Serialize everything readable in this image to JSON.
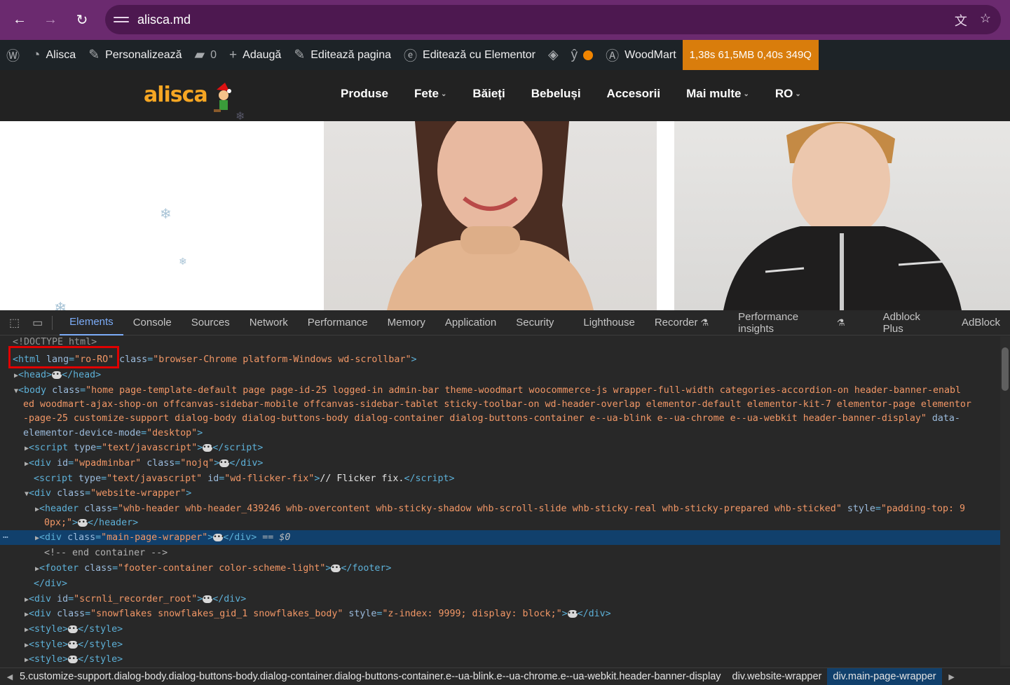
{
  "browser": {
    "url": "alisca.md",
    "back_icon": "←",
    "forward_icon": "→",
    "reload_icon": "↻"
  },
  "wpbar": {
    "site_name": "Alisca",
    "customize": "Personalizează",
    "comments_count": "0",
    "add_new": "Adaugă",
    "edit_page": "Editează pagina",
    "edit_elementor": "Editează cu Elementor",
    "woodmart": "WoodMart",
    "perf": "1,38s  61,5MB  0,40s  349Q"
  },
  "site": {
    "logo_text": "alisca",
    "nav": [
      "Produse",
      "Fete",
      "Băieți",
      "Bebeluși",
      "Accesorii",
      "Mai multe",
      "RO"
    ],
    "caret": "⌄"
  },
  "devtools": {
    "tabs": [
      "Elements",
      "Console",
      "Sources",
      "Network",
      "Performance",
      "Memory",
      "Application",
      "Security",
      "Lighthouse",
      "Recorder",
      "Performance insights",
      "Adblock Plus",
      "AdBlock"
    ],
    "doctype": "<!DOCTYPE html>",
    "html_line": {
      "tag_open": "<html ",
      "lang_attr": "lang",
      "lang_val": "\"ro-RO\"",
      "class_attr": "class",
      "class_val": "\"browser-Chrome platform-Windows wd-scrollbar\""
    },
    "head": {
      "open": "<head>",
      "close": "</head>"
    },
    "body_line1": "home page-template-default page page-id-25 logged-in admin-bar theme-woodmart woocommerce-js wrapper-full-width categories-accordion-on header-banner-enabl",
    "body_line2": "ed woodmart-ajax-shop-on offcanvas-sidebar-mobile offcanvas-sidebar-tablet sticky-toolbar-on wd-header-overlap elementor-default elementor-kit-7 elementor-page elementor",
    "body_line3": "-page-25 customize-support dialog-body dialog-buttons-body dialog-container dialog-buttons-container e--ua-blink e--ua-chrome e--ua-webkit header-banner-display",
    "body_line3_attr": "data-",
    "body_line4_attr": "elementor-device-mode",
    "body_line4_val": "\"desktop\"",
    "script1_type": "\"text/javascript\"",
    "wpadminbar_id": "\"wpadminbar\"",
    "wpadminbar_class": "\"nojq\"",
    "flicker_type": "\"text/javascript\"",
    "flicker_id": "\"wd-flicker-fix\"",
    "flicker_text": "// Flicker fix.",
    "wrapper_class": "\"website-wrapper\"",
    "header_class": "\"whb-header whb-header_439246 whb-overcontent whb-sticky-shadow whb-scroll-slide whb-sticky-real whb-sticky-prepared whb-sticked\"",
    "header_style_attr": "style",
    "header_style_val1": "\"padding-top: 9",
    "header_style_val2": "0px;\"",
    "main_class": "\"main-page-wrapper\"",
    "selected_marker": "== $0",
    "comment": "<!-- end container -->",
    "footer_class": "\"footer-container color-scheme-light\"",
    "recorder_id": "\"scrnli_recorder_root\"",
    "snow_class": "\"snowflakes snowflakes_gid_1 snowflakes_body\"",
    "snow_style": "\"z-index: 9999; display: block;\"",
    "style_tag": "style"
  },
  "breadcrumbs": [
    "5.customize-support.dialog-body.dialog-buttons-body.dialog-container.dialog-buttons-container.e--ua-blink.e--ua-chrome.e--ua-webkit.header-banner-display",
    "div.website-wrapper",
    "div.main-page-wrapper"
  ]
}
